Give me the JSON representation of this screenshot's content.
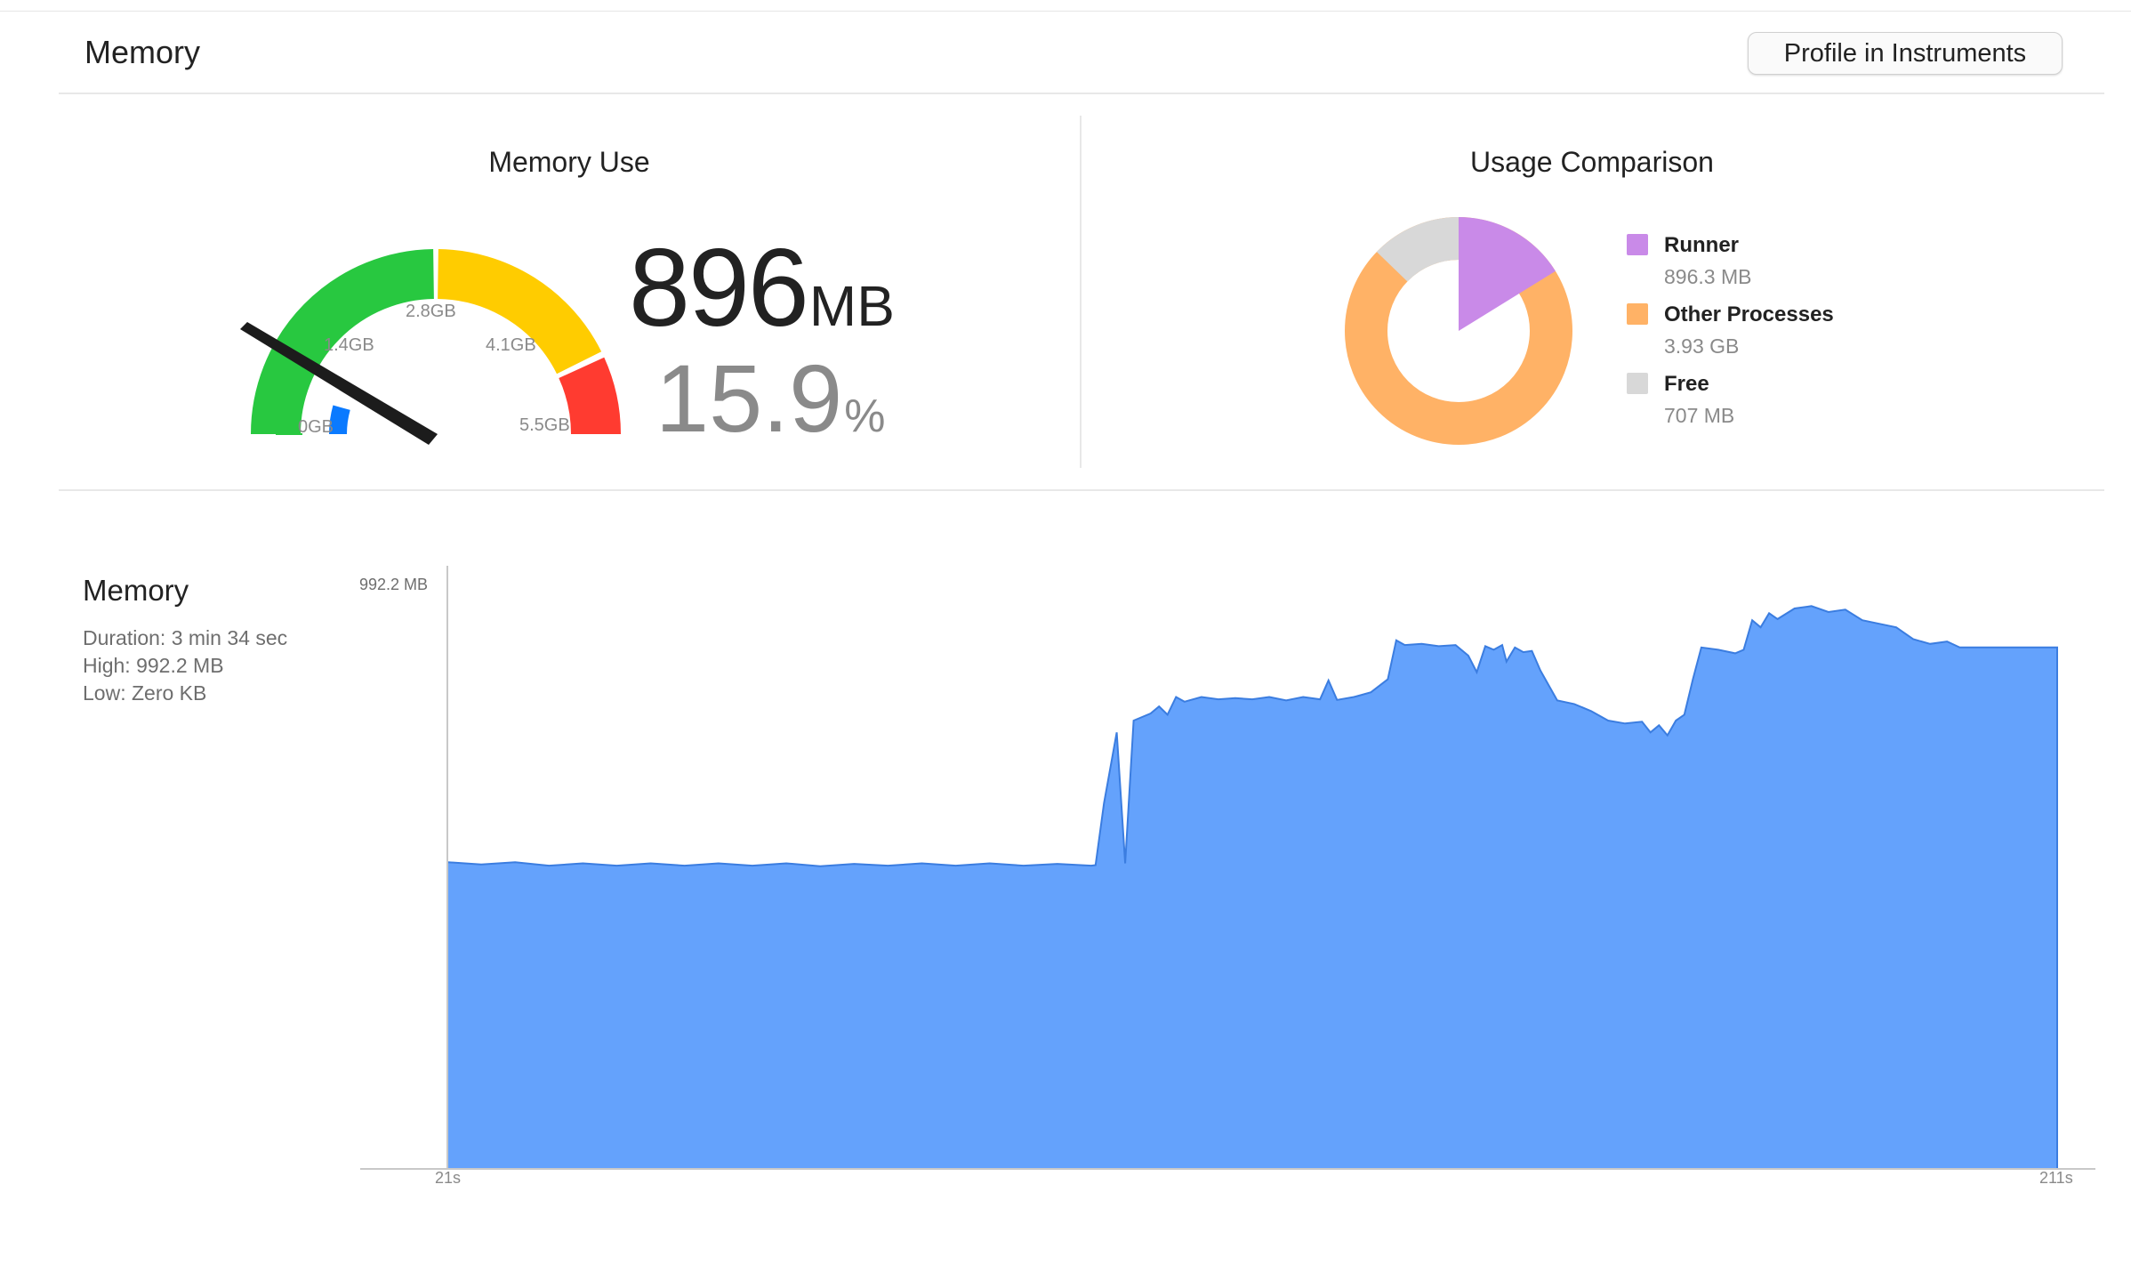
{
  "header": {
    "title": "Memory",
    "profile_button_label": "Profile in Instruments"
  },
  "gauge_panel": {
    "title": "Memory Use",
    "value_mb": "896",
    "value_mb_unit": "MB",
    "value_percent": "15.9",
    "value_percent_unit": "%",
    "fill_fraction": 0.159,
    "tick_labels": [
      "0GB",
      "1.4GB",
      "2.8GB",
      "4.1GB",
      "5.5GB"
    ],
    "colors": {
      "green": "#28c840",
      "yellow": "#ffcc00",
      "red": "#ff3b30",
      "blue": "#0a7aff",
      "needle": "#1c1c1c"
    }
  },
  "comparison_panel": {
    "title": "Usage Comparison",
    "legend": [
      {
        "name": "Runner",
        "value": "896.3 MB",
        "color": "#c98ae8"
      },
      {
        "name": "Other Processes",
        "value": "3.93 GB",
        "color": "#ffb266"
      },
      {
        "name": "Free",
        "value": "707 MB",
        "color": "#d8d8d8"
      }
    ]
  },
  "history": {
    "title": "Memory",
    "duration_text": "Duration: 3 min 34 sec",
    "high_text": "High: 992.2 MB",
    "low_text": "Low: Zero KB",
    "y_max_label": "992.2 MB",
    "x_start_label": "21s",
    "x_end_label": "211s",
    "fill_color": "#64a2fc",
    "line_color": "#3b7de0"
  },
  "chart_data": {
    "type": "area",
    "x_range": [
      21,
      211
    ],
    "ylim": [
      0,
      992.2
    ],
    "points": [
      [
        21,
        520
      ],
      [
        25,
        516
      ],
      [
        29,
        520
      ],
      [
        33,
        514
      ],
      [
        37,
        518
      ],
      [
        41,
        514
      ],
      [
        45,
        518
      ],
      [
        49,
        514
      ],
      [
        53,
        518
      ],
      [
        57,
        514
      ],
      [
        61,
        518
      ],
      [
        65,
        513
      ],
      [
        69,
        517
      ],
      [
        73,
        514
      ],
      [
        77,
        518
      ],
      [
        81,
        514
      ],
      [
        85,
        518
      ],
      [
        89,
        514
      ],
      [
        93,
        517
      ],
      [
        97,
        514
      ],
      [
        101,
        518
      ],
      [
        97.5,
        515
      ],
      [
        98.5,
        620
      ],
      [
        100,
        740
      ],
      [
        102,
        760
      ],
      [
        104,
        772
      ],
      [
        105,
        784
      ],
      [
        106,
        770
      ],
      [
        107,
        800
      ],
      [
        108,
        792
      ],
      [
        110,
        800
      ],
      [
        112,
        796
      ],
      [
        114,
        798
      ],
      [
        116,
        796
      ],
      [
        118,
        800
      ],
      [
        120,
        794
      ],
      [
        122,
        800
      ],
      [
        124,
        796
      ],
      [
        125,
        828
      ],
      [
        126,
        795
      ],
      [
        128,
        800
      ],
      [
        130,
        808
      ],
      [
        132,
        830
      ],
      [
        133,
        896
      ],
      [
        134,
        888
      ],
      [
        136,
        890
      ],
      [
        138,
        886
      ],
      [
        140,
        888
      ],
      [
        141.5,
        870
      ],
      [
        142.5,
        842
      ],
      [
        143.5,
        886
      ],
      [
        144.5,
        880
      ],
      [
        145.5,
        888
      ],
      [
        146,
        860
      ],
      [
        147,
        884
      ],
      [
        148,
        876
      ],
      [
        149,
        878
      ],
      [
        150,
        845
      ],
      [
        152,
        794
      ],
      [
        154,
        788
      ],
      [
        156,
        776
      ],
      [
        158,
        760
      ],
      [
        160,
        755
      ],
      [
        162,
        758
      ],
      [
        163,
        740
      ],
      [
        164,
        752
      ],
      [
        165,
        735
      ],
      [
        166,
        760
      ],
      [
        167,
        770
      ],
      [
        168,
        830
      ],
      [
        169,
        884
      ],
      [
        171,
        880
      ],
      [
        173,
        874
      ],
      [
        174,
        880
      ],
      [
        175,
        930
      ],
      [
        176,
        918
      ],
      [
        177,
        942
      ],
      [
        178,
        932
      ],
      [
        180,
        950
      ],
      [
        182,
        954
      ],
      [
        184,
        944
      ],
      [
        186,
        948
      ],
      [
        188,
        930
      ],
      [
        190,
        924
      ],
      [
        192,
        918
      ],
      [
        194,
        898
      ],
      [
        196,
        890
      ],
      [
        198,
        894
      ],
      [
        199.5,
        884
      ]
    ],
    "title": "Memory",
    "xlabel": "",
    "ylabel": ""
  }
}
